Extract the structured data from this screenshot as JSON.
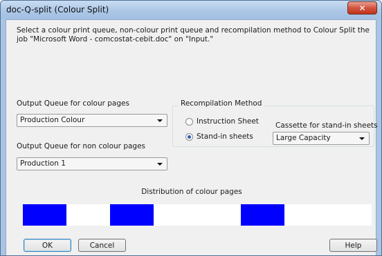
{
  "window": {
    "title": "doc-Q-split (Colour Split)",
    "close_glyph": "✕"
  },
  "message": "Select a colour print queue, non-colour print queue and recompilation method to Colour Split the job \"Microsoft Word - comcostat-cebit.doc\" on \"Input.\"",
  "colour_queue": {
    "label": "Output Queue for colour pages",
    "value": "Production Colour"
  },
  "noncolour_queue": {
    "label": "Output Queue for non colour pages",
    "value": "Production 1"
  },
  "recompilation": {
    "title": "Recompilation Method",
    "options": [
      {
        "label": "Instruction Sheet",
        "selected": false
      },
      {
        "label": "Stand-in sheets",
        "selected": true
      }
    ],
    "cassette": {
      "label": "Cassette for stand-in sheets",
      "value": "Large Capacity"
    }
  },
  "distribution": {
    "label": "Distribution of colour pages",
    "pages": [
      true,
      false,
      true,
      false,
      false,
      true,
      false,
      false
    ],
    "colour_hex": "#0000ff"
  },
  "buttons": {
    "ok": "OK",
    "cancel": "Cancel",
    "help": "Help"
  }
}
